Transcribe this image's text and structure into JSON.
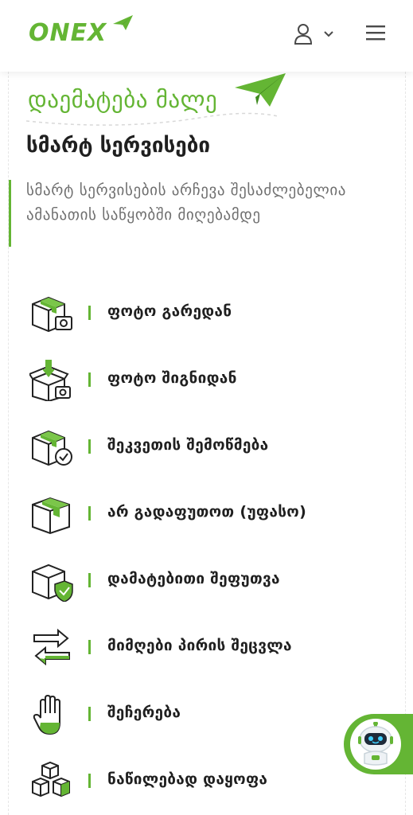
{
  "header": {
    "logo_text": "ONEX",
    "user_icon": "user-icon",
    "dropdown_icon": "chevron-down-icon",
    "menu_icon": "hamburger-menu-icon"
  },
  "section": {
    "eyebrow": "დაემატება მალე",
    "title": "სმარტ სერვისები",
    "description": "სმარტ სერვისების არჩევა შესაძლებელია ამანათის საწყობში მიღებამდე"
  },
  "services": [
    {
      "label": "ფოტო გარედან",
      "icon": "box-photo-outside-icon"
    },
    {
      "label": "ფოტო შიგნიდან",
      "icon": "box-photo-inside-icon"
    },
    {
      "label": "შეკვეთის შემოწმება",
      "icon": "box-check-icon"
    },
    {
      "label": "არ გადაფუთოთ (უფასო)",
      "icon": "box-no-repack-icon"
    },
    {
      "label": "დამატებითი შეფუთვა",
      "icon": "box-shield-icon"
    },
    {
      "label": "მიმღები პირის შეცვლა",
      "icon": "swap-arrows-icon"
    },
    {
      "label": "შეჩერება",
      "icon": "stop-hand-icon"
    },
    {
      "label": "ნაწილებად დაყოფა",
      "icon": "split-boxes-icon"
    }
  ],
  "chat": {
    "icon": "chatbot-robot-icon"
  },
  "colors": {
    "accent": "#64b534",
    "text": "#1f1f1f",
    "muted": "#6f6f6f"
  }
}
